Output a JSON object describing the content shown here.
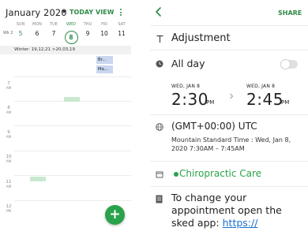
{
  "calendar": {
    "month_title": "January 2020",
    "today_label": "TODAY",
    "view_label": "VIEW",
    "week_label": "Wk 2",
    "days": [
      {
        "name": "SUN",
        "num": "5"
      },
      {
        "name": "MON",
        "num": "6"
      },
      {
        "name": "TUE",
        "num": "7"
      },
      {
        "name": "WED",
        "num": "8"
      },
      {
        "name": "THU",
        "num": "9"
      },
      {
        "name": "FRI",
        "num": "10"
      },
      {
        "name": "SAT",
        "num": "11"
      }
    ],
    "allday_text": "Winter: 19,12,21 >20,03,19",
    "chips": [
      "Br...",
      "Ma..."
    ],
    "hours": [
      {
        "h": "7",
        "ampm": "AM"
      },
      {
        "h": "8",
        "ampm": "AM"
      },
      {
        "h": "9",
        "ampm": "AM"
      },
      {
        "h": "10",
        "ampm": "AM"
      },
      {
        "h": "11",
        "ampm": "AM"
      },
      {
        "h": "12",
        "ampm": "PM"
      }
    ],
    "fab_label": "+"
  },
  "detail": {
    "share_label": "SHARE",
    "title": "Adjustment",
    "allday_label": "All day",
    "start_date": "WED, JAN 8",
    "start_time": "2:30",
    "start_ampm": "PM",
    "end_date": "WED, JAN 8",
    "end_time": "2:45",
    "end_ampm": "PM",
    "timezone": "(GMT+00:00) UTC",
    "timezone_detail": "Mountain Standard Time : Wed, Jan 8, 2020 7:30AM – 7:45AM",
    "calendar_name": "Chiropractic Care",
    "notes_text": "To change your appointment open the sked app: ",
    "notes_link": "https://"
  },
  "colors": {
    "accent": "#2e8a47",
    "fab": "#2aa24b",
    "chip": "#c9d6ef",
    "mini_event": "#c8e8cf",
    "link": "#1a6fd1"
  },
  "icons": [
    "more-vert-icon",
    "back-arrow-icon",
    "text-t-icon",
    "clock-icon",
    "globe-icon",
    "calendar-dot-icon",
    "notes-icon",
    "plus-icon",
    "chevron-right-icon"
  ]
}
